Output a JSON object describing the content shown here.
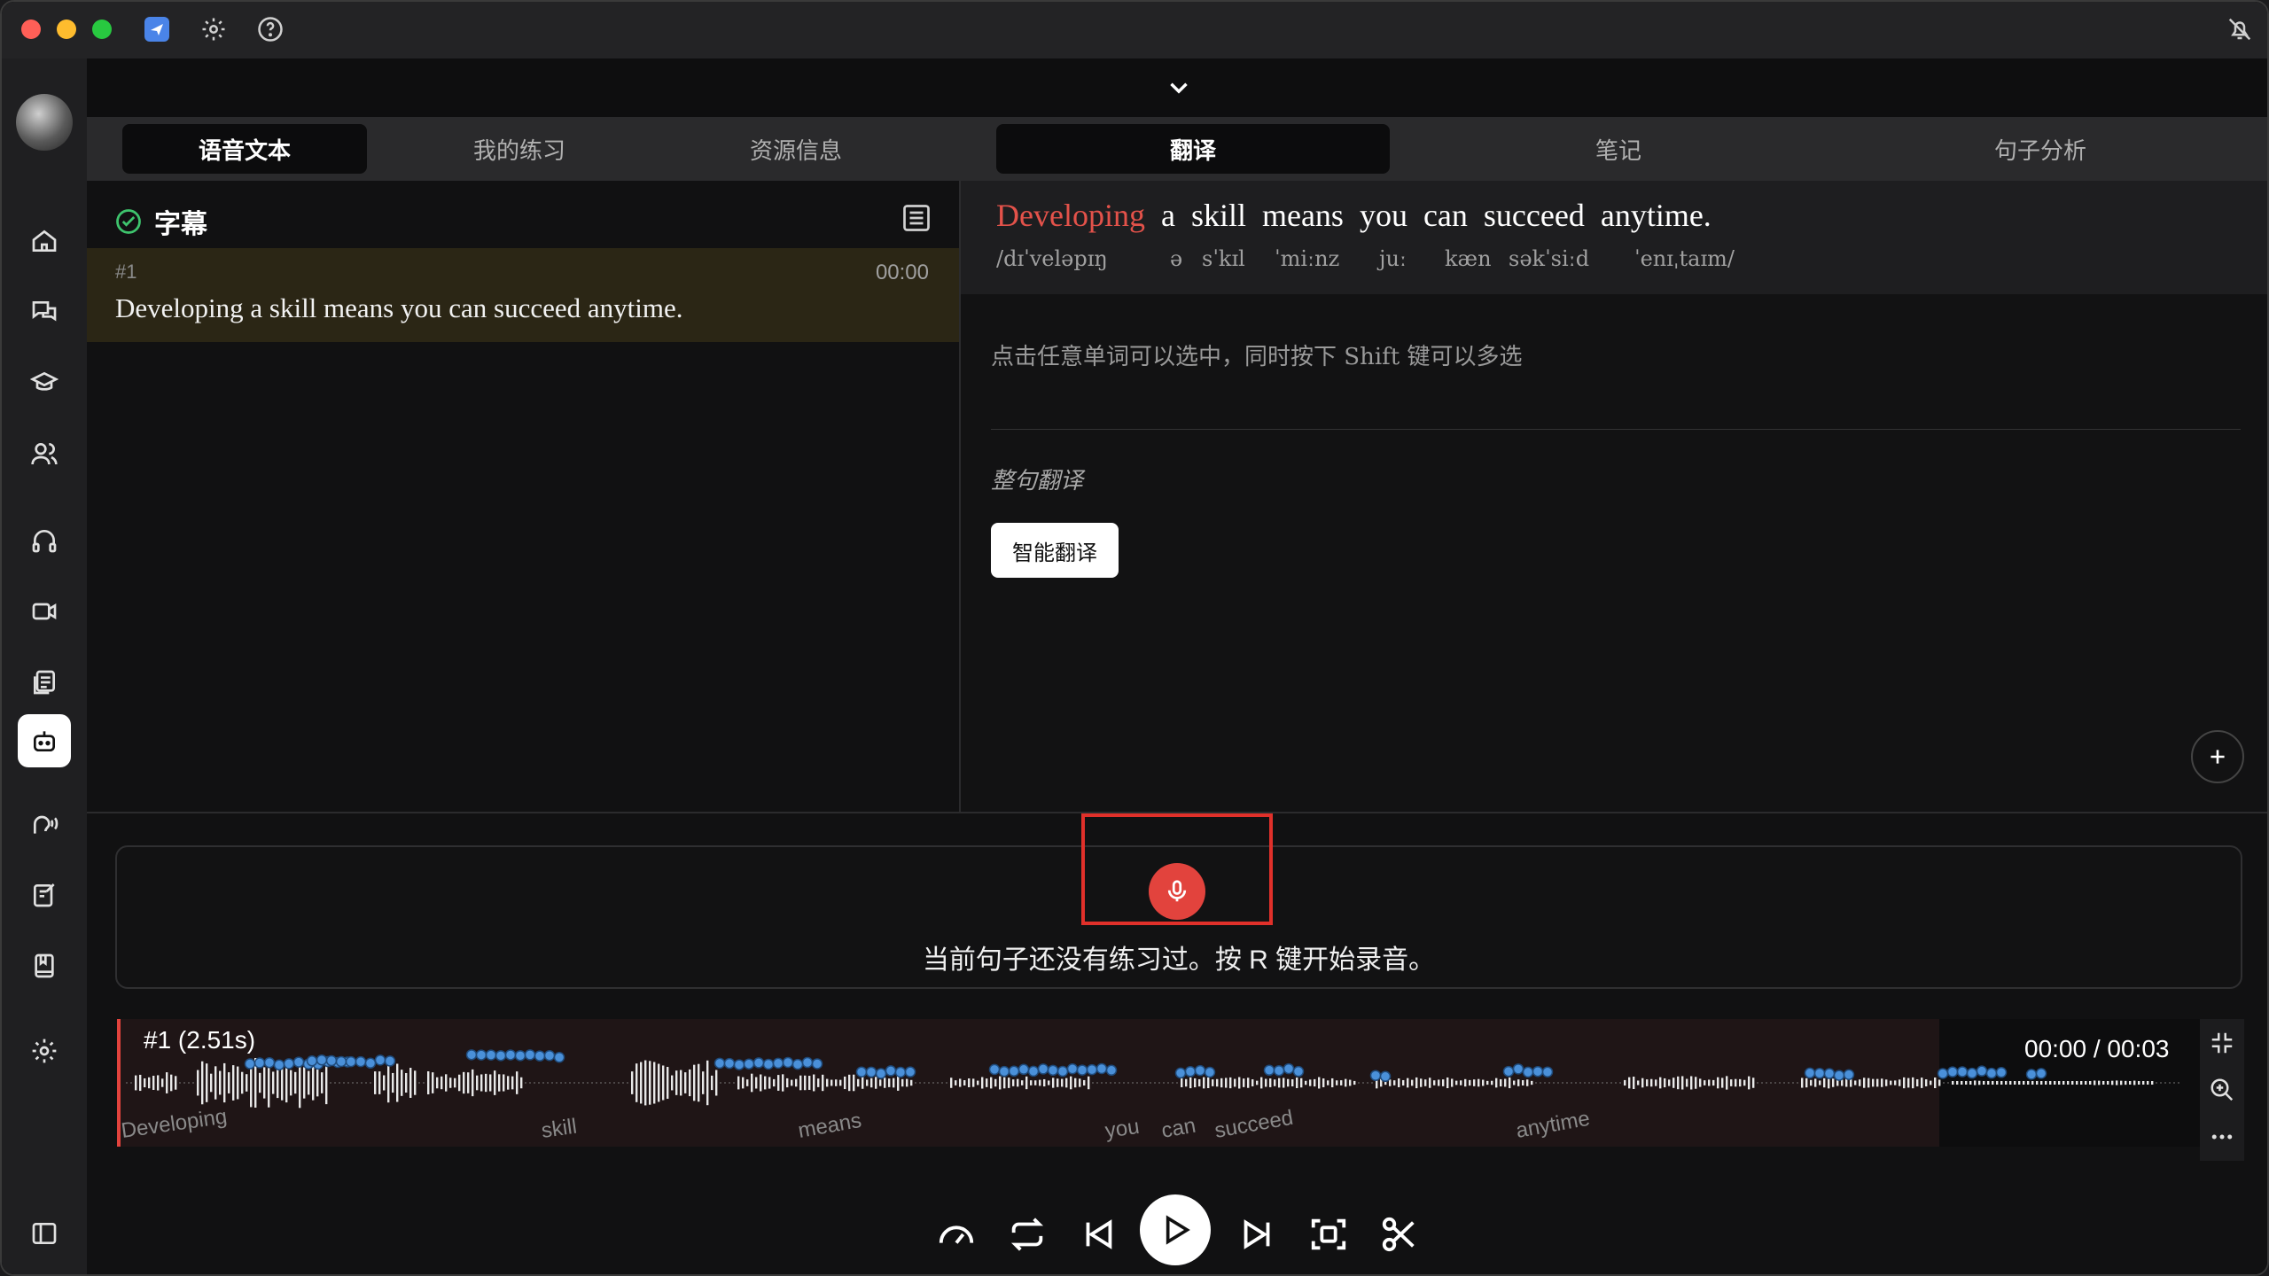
{
  "tabs_left": [
    {
      "label": "语音文本",
      "active": true
    },
    {
      "label": "我的练习",
      "active": false
    },
    {
      "label": "资源信息",
      "active": false
    }
  ],
  "tabs_right": [
    {
      "label": "翻译",
      "active": true
    },
    {
      "label": "笔记",
      "active": false
    },
    {
      "label": "句子分析",
      "active": false
    }
  ],
  "subtitles": {
    "title": "字幕",
    "cue": {
      "number": "#1",
      "time": "00:00",
      "text": "Developing a skill means you can succeed anytime."
    }
  },
  "translation": {
    "words": [
      "Developing",
      "a",
      "skill",
      "means",
      "you",
      "can",
      "succeed",
      "anytime."
    ],
    "selected_word": "Developing",
    "phonetics": [
      "/dɪˈveləpɪŋ",
      "ə",
      "sˈkɪl",
      "ˈmiːnz",
      "juː",
      "kæn",
      "səkˈsiːd",
      "ˈenɪˌtaɪm/"
    ],
    "hint": "点击任意单词可以选中，同时按下 Shift 键可以多选",
    "section_title": "整句翻译",
    "smart_translate_label": "智能翻译"
  },
  "recorder": {
    "message": "当前句子还没有练习过。按 R 键开始录音。"
  },
  "waveform": {
    "segment_label": "#1 (2.51s)",
    "time": "00:00 / 00:03",
    "words": [
      "Developing",
      "skill",
      "means",
      "you",
      "can",
      "succeed",
      "anytime"
    ]
  },
  "colors": {
    "accent_red": "#e2433d",
    "pitch_blue": "#4a90d9",
    "selected_cue_bg": "#2b2615"
  }
}
